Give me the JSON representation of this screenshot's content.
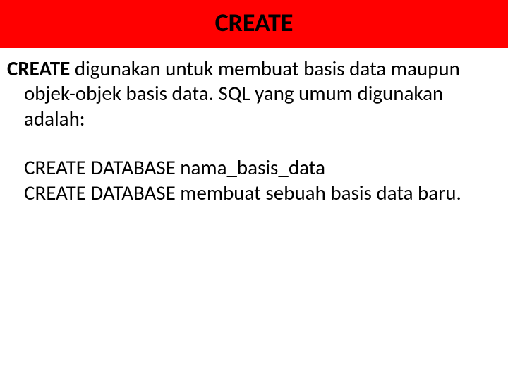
{
  "header": {
    "title": "CREATE"
  },
  "body": {
    "p1_bold": "CREATE",
    "p1_rest": " digunakan untuk membuat basis data maupun objek-objek basis data. SQL yang umum digunakan adalah:",
    "p2_line1": "CREATE DATABASE nama_basis_data",
    "p2_line2": "CREATE DATABASE membuat sebuah basis data baru."
  }
}
